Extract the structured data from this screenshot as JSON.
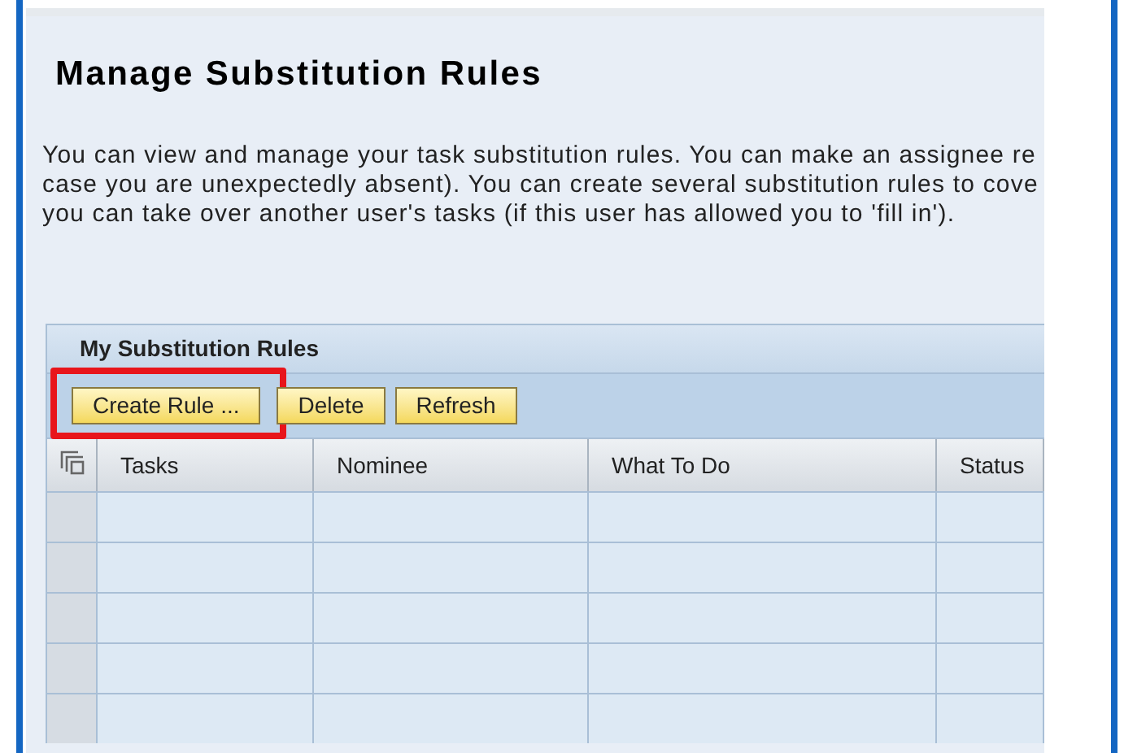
{
  "title": "Manage Substitution Rules",
  "description_lines": [
    "You can view and manage your task substitution rules. You can make an assignee re",
    "case you are unexpectedly absent). You can create several substitution rules to cove",
    "you can take over another user's tasks (if this user has allowed you to 'fill in')."
  ],
  "table": {
    "title": "My Substitution Rules",
    "buttons": [
      {
        "label": "Create Rule ...",
        "highlighted": true
      },
      {
        "label": "Delete",
        "highlighted": false
      },
      {
        "label": "Refresh",
        "highlighted": false
      }
    ],
    "columns": [
      "Tasks",
      "Nominee",
      "What To Do",
      "Status"
    ]
  }
}
